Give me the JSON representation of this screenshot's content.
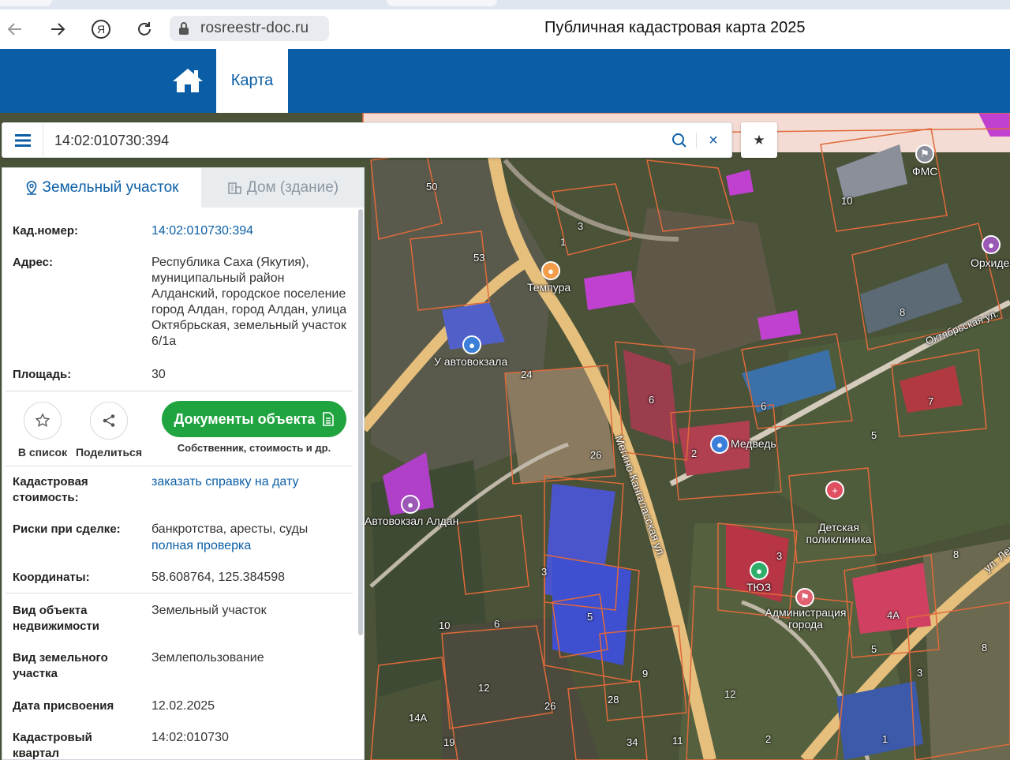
{
  "browser": {
    "url": "rosreestr-doc.ru",
    "title": "Публичная кадастровая карта 2025",
    "icons": [
      "back-icon",
      "forward-icon",
      "yandex-icon",
      "reload-icon",
      "lock-icon"
    ]
  },
  "header": {
    "home_icon": "home-icon",
    "tab_label": "Карта",
    "accent": "#0b5ea6"
  },
  "search": {
    "value": "14:02:010730:394",
    "clear": "×",
    "favorite": "★"
  },
  "panel": {
    "tabs": [
      {
        "label": "Земельный участок",
        "icon": "pin-icon",
        "active": true
      },
      {
        "label": "Дом (здание)",
        "icon": "building-icon",
        "active": false
      }
    ],
    "fields": {
      "cad_number": {
        "label": "Кад.номер:",
        "value": "14:02:010730:394"
      },
      "address": {
        "label": "Адрес:",
        "value": "Республика Саха (Якутия), муниципальный район Алданский, городское поселение город Алдан, город Алдан, улица Октябрьская, земельный участок 6/1а"
      },
      "area": {
        "label": "Площадь:",
        "value": "30"
      },
      "cad_cost": {
        "label": "Кадастровая стоимость:",
        "value": "заказать справку на дату"
      },
      "risks": {
        "label": "Риски при сделке:",
        "value": "банкротства, аресты, суды",
        "link": "полная проверка"
      },
      "coords": {
        "label": "Координаты:",
        "value": "58.608764, 125.384598"
      },
      "object_type": {
        "label": "Вид объекта недвижимости",
        "value": "Земельный участок"
      },
      "land_type": {
        "label": "Вид земельного участка",
        "value": "Землепользование"
      },
      "assign_date": {
        "label": "Дата присвоения",
        "value": "12.02.2025"
      },
      "cad_quarter": {
        "label": "Кадастровый квартал",
        "value": "14:02:010730"
      }
    },
    "actions": {
      "add_to_list": "В список",
      "share": "Поделиться",
      "docs_button": "Документы объекта",
      "docs_sub": "Собственник, стоимость и др."
    },
    "docs_color": "#20a440"
  },
  "map": {
    "labels": [
      "Темпура",
      "У автовокзала",
      "Автовокзал Алдан",
      "Медведь",
      "Детская поликлиника",
      "ТЮЗ",
      "Администрация города",
      "ФМС",
      "Орхидея",
      "Октябрьская ул.",
      "Мегино-Кангаласская ул.",
      "ул. Ленина"
    ],
    "house_numbers": [
      "50",
      "53",
      "3",
      "1",
      "10",
      "8",
      "6",
      "6",
      "7",
      "5",
      "2",
      "26",
      "24",
      "3",
      "5",
      "3",
      "4А",
      "8",
      "12",
      "9",
      "28",
      "26",
      "12",
      "14А",
      "19",
      "34",
      "11",
      "1",
      "2",
      "3",
      "5",
      "8",
      "10",
      "6"
    ]
  }
}
